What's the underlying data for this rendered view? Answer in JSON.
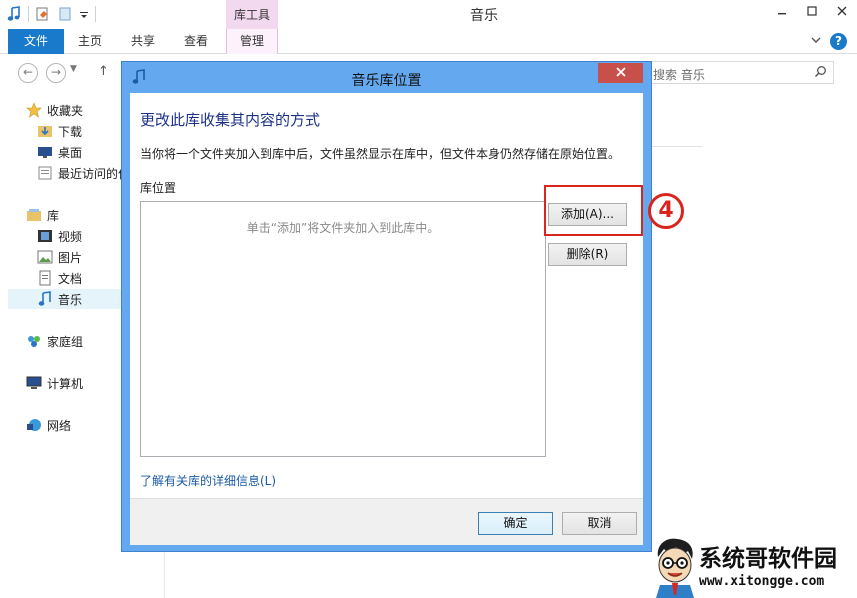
{
  "window": {
    "title": "音乐",
    "context_tab_group": "库工具"
  },
  "ribbon": {
    "tabs": [
      "文件",
      "主页",
      "共享",
      "查看",
      "管理"
    ]
  },
  "address": {
    "search_placeholder": "搜索 音乐"
  },
  "nav": {
    "favorites": "收藏夹",
    "downloads": "下载",
    "desktop": "桌面",
    "recent": "最近访问的位置",
    "libraries": "库",
    "videos": "视频",
    "pictures": "图片",
    "documents": "文档",
    "music": "音乐",
    "homegroup": "家庭组",
    "computer": "计算机",
    "network": "网络"
  },
  "dialog": {
    "title": "音乐库位置",
    "heading": "更改此库收集其内容的方式",
    "description": "当你将一个文件夹加入到库中后，文件虽然显示在库中，但文件本身仍然存储在原始位置。",
    "locations_label": "库位置",
    "empty_hint": "单击“添加”将文件夹加入到此库中。",
    "add_button": "添加(A)...",
    "remove_button": "删除(R)",
    "learn_more_link": "了解有关库的详细信息(L)",
    "ok_button": "确定",
    "cancel_button": "取消"
  },
  "annotation": {
    "step": "4"
  },
  "watermark": {
    "text": "系统哥软件园",
    "url": "www.xitongge.com"
  },
  "colors": {
    "ribbon_file_tab": "#1979ca",
    "dialog_frame": "#64a9f0",
    "close_button": "#c7504a",
    "heading": "#1e3287",
    "highlight": "#d9251d",
    "link": "#1a5aa6"
  }
}
